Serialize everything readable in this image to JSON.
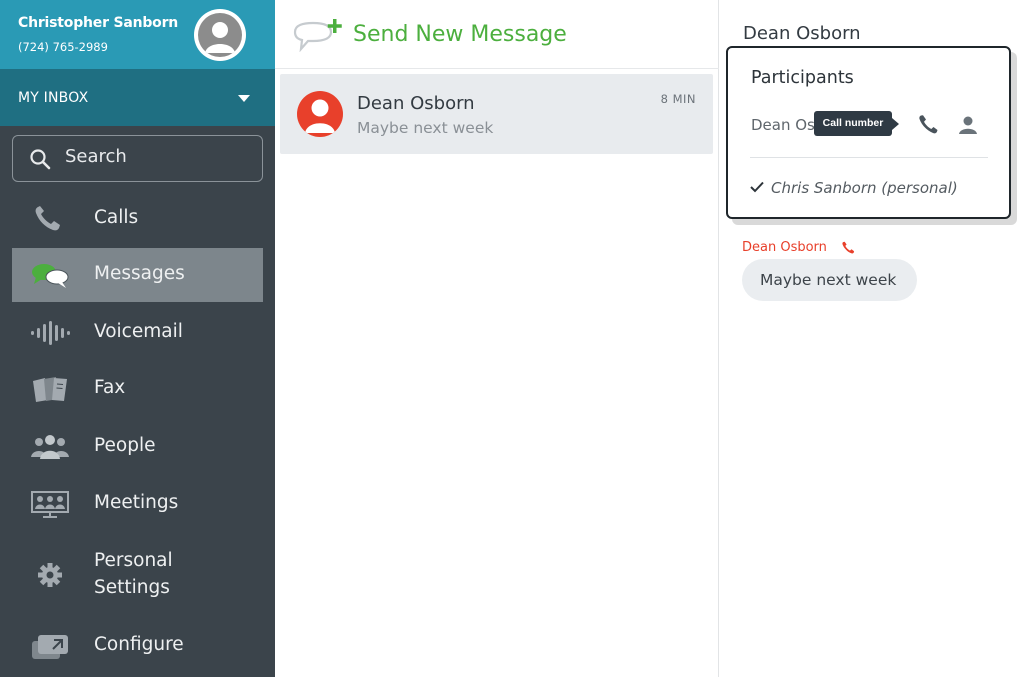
{
  "user": {
    "name": "Christopher Sanborn",
    "phone": "(724) 765-2989"
  },
  "inbox": {
    "label": "MY INBOX"
  },
  "search": {
    "label": "Search"
  },
  "nav": {
    "calls": "Calls",
    "messages": "Messages",
    "voicemail": "Voicemail",
    "fax": "Fax",
    "people": "People",
    "meetings": "Meetings",
    "settings_line1": "Personal",
    "settings_line2": "Settings",
    "configure": "Configure"
  },
  "compose": {
    "label": "Send New Message"
  },
  "conversation": {
    "name": "Dean Osborn",
    "preview": "Maybe next week",
    "time": "8 MIN"
  },
  "thread": {
    "title": "Dean Osborn"
  },
  "participants": {
    "title": "Participants",
    "contact_name": "Dean Osborn",
    "tooltip": "Call number",
    "self": "Chris Sanborn (personal)"
  },
  "message": {
    "sender": "Dean Osborn",
    "text": "Maybe next week"
  },
  "colors": {
    "header_teal": "#2a9ab5",
    "inbox_bar": "#1f6f82",
    "sidebar": "#3b444b",
    "active_nav": "#7d868c",
    "accent_green": "#4caf3e",
    "contact_red": "#e8402b"
  }
}
